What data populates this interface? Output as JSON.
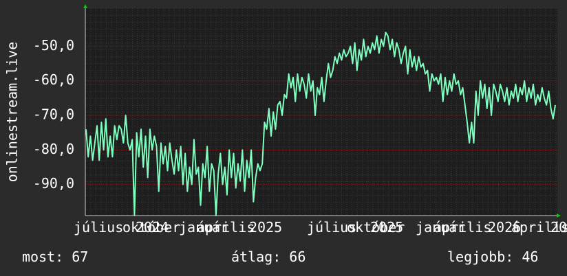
{
  "chart_data": {
    "type": "line",
    "ylabel": "onlinestream.live",
    "ylim": [
      -99,
      -39
    ],
    "y_ticks": [
      -50,
      -60,
      -70,
      -80,
      -90
    ],
    "y_tick_labels": [
      "-50,0",
      "-60,0",
      "-70,0",
      "-80,0",
      "-90,0"
    ],
    "x_tick_labels": [
      "július",
      "október",
      "2024",
      "január",
      "április",
      "2025",
      "július",
      "október",
      "2025",
      "január",
      "április",
      "2026",
      "április",
      "20"
    ],
    "grid": true,
    "colors": {
      "line": "#7fffbf",
      "background": "#2b2b2b",
      "plot_bg": "#1e1e1e",
      "grid": "#4a4a4a",
      "axis_arrow": "#00cc00"
    },
    "series": [
      {
        "values": [
          -74,
          -82,
          -76,
          -83,
          -78,
          -73,
          -83,
          -72,
          -80,
          -71,
          -82,
          -76,
          -82,
          -73,
          -77,
          -73,
          -74,
          -78,
          -70,
          -78,
          -80,
          -77,
          -99,
          -75,
          -82,
          -74,
          -85,
          -76,
          -88,
          -74,
          -80,
          -76,
          -79,
          -92,
          -78,
          -84,
          -79,
          -86,
          -78,
          -83,
          -87,
          -80,
          -86,
          -79,
          -90,
          -81,
          -92,
          -85,
          -90,
          -77,
          -87,
          -85,
          -96,
          -84,
          -88,
          -79,
          -92,
          -84,
          -86,
          -99,
          -87,
          -81,
          -90,
          -85,
          -93,
          -80,
          -88,
          -81,
          -91,
          -84,
          -89,
          -80,
          -92,
          -83,
          -88,
          -80,
          -95,
          -88,
          -84,
          -86,
          -84,
          -72,
          -74,
          -68,
          -76,
          -69,
          -74,
          -67,
          -66,
          -70,
          -64,
          -65,
          -58,
          -62,
          -59,
          -66,
          -58,
          -63,
          -59,
          -61,
          -65,
          -58,
          -63,
          -60,
          -70,
          -62,
          -64,
          -59,
          -66,
          -60,
          -55,
          -59,
          -57,
          -53,
          -55,
          -52,
          -54,
          -51,
          -53,
          -52,
          -50,
          -55,
          -49,
          -57,
          -51,
          -54,
          -48,
          -53,
          -50,
          -52,
          -49,
          -51,
          -47,
          -52,
          -48,
          -50,
          -46,
          -47,
          -51,
          -48,
          -53,
          -49,
          -51,
          -55,
          -52,
          -50,
          -58,
          -51,
          -56,
          -53,
          -57,
          -53,
          -56,
          -55,
          -58,
          -57,
          -63,
          -58,
          -60,
          -59,
          -61,
          -58,
          -66,
          -59,
          -64,
          -60,
          -63,
          -58,
          -61,
          -60,
          -64,
          -62,
          -67,
          -72,
          -78,
          -72,
          -78,
          -63,
          -70,
          -60,
          -65,
          -61,
          -68,
          -62,
          -70,
          -61,
          -63,
          -66,
          -61,
          -63,
          -66,
          -62,
          -67,
          -63,
          -65,
          -61,
          -66,
          -62,
          -64,
          -60,
          -66,
          -62,
          -65,
          -61,
          -67,
          -64,
          -66,
          -62,
          -65,
          -67,
          -63,
          -68,
          -71,
          -67
        ],
        "name": ""
      }
    ]
  },
  "stats": {
    "current": "most: 67",
    "average": "átlag: 66",
    "best": "legjobb: 46"
  }
}
